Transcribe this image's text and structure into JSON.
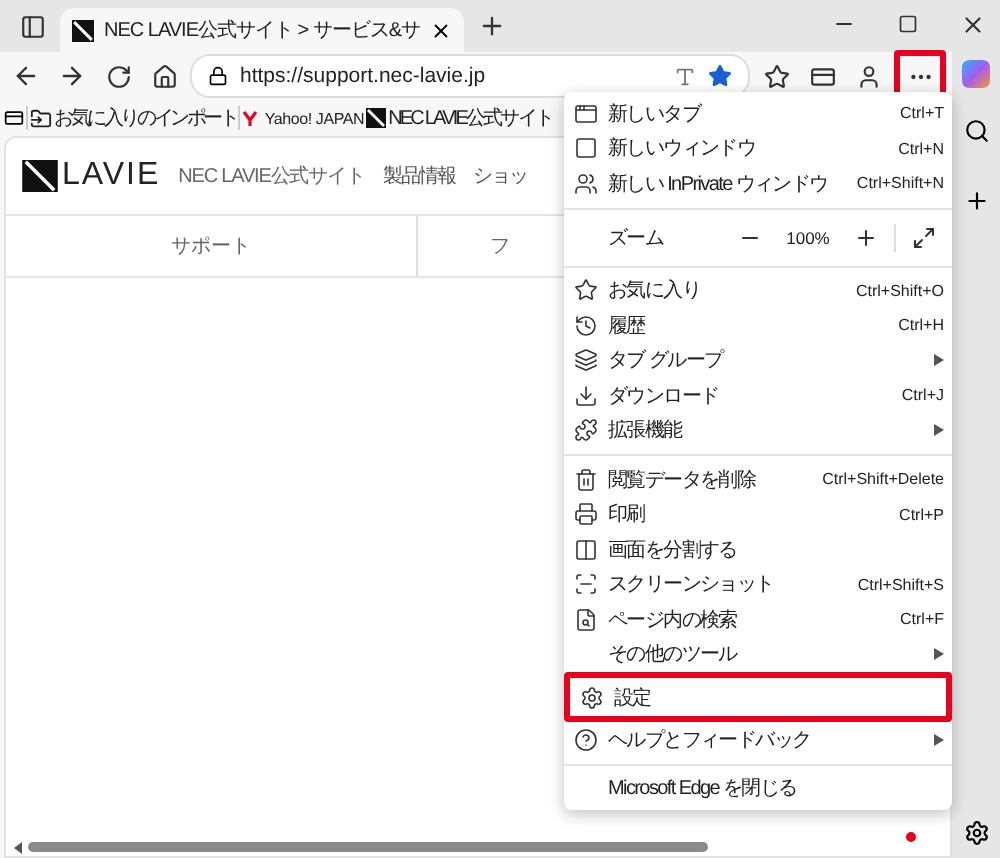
{
  "tab": {
    "title": "NEC LAVIE公式サイト > サービス&サ",
    "selected": true
  },
  "address_bar": {
    "url": "https://support.nec-lavie.jp",
    "favorited": true
  },
  "more_button": {
    "highlighted": true
  },
  "bookmarks": [
    {
      "label": "お気に入りのインポート"
    },
    {
      "label": "Yahoo! JAPAN"
    },
    {
      "label": "NEC LAVIE公式サイト"
    }
  ],
  "page": {
    "logo": "LAVIE",
    "site_name": "NEC LAVIE公式サイト",
    "nav": [
      "製品情報",
      "ショッ"
    ],
    "subnav": [
      "サポート",
      "フ"
    ]
  },
  "menu": {
    "items": [
      {
        "kind": "item",
        "label": "新しいタブ",
        "shortcut": "Ctrl+T",
        "submenu": false,
        "highlighted": false
      },
      {
        "kind": "item",
        "label": "新しいウィンドウ",
        "shortcut": "Ctrl+N",
        "submenu": false,
        "highlighted": false
      },
      {
        "kind": "item",
        "label": "新しい InPrivate ウィンドウ",
        "shortcut": "Ctrl+Shift+N",
        "submenu": false,
        "highlighted": false
      },
      {
        "kind": "separator"
      },
      {
        "kind": "zoom",
        "label": "ズーム",
        "value": "100%"
      },
      {
        "kind": "separator"
      },
      {
        "kind": "item",
        "label": "お気に入り",
        "shortcut": "Ctrl+Shift+O",
        "submenu": false,
        "highlighted": false
      },
      {
        "kind": "item",
        "label": "履歴",
        "shortcut": "Ctrl+H",
        "submenu": false,
        "highlighted": false
      },
      {
        "kind": "item",
        "label": "タブ グループ",
        "submenu": true,
        "highlighted": false
      },
      {
        "kind": "item",
        "label": "ダウンロード",
        "shortcut": "Ctrl+J",
        "submenu": false,
        "highlighted": false
      },
      {
        "kind": "item",
        "label": "拡張機能",
        "submenu": true,
        "highlighted": false
      },
      {
        "kind": "separator"
      },
      {
        "kind": "item",
        "label": "閲覧データを削除",
        "shortcut": "Ctrl+Shift+Delete",
        "submenu": false,
        "highlighted": false
      },
      {
        "kind": "item",
        "label": "印刷",
        "shortcut": "Ctrl+P",
        "submenu": false,
        "highlighted": false
      },
      {
        "kind": "item",
        "label": "画面を分割する",
        "submenu": false,
        "highlighted": false
      },
      {
        "kind": "item",
        "label": "スクリーンショット",
        "shortcut": "Ctrl+Shift+S",
        "submenu": false,
        "highlighted": false
      },
      {
        "kind": "item",
        "label": "ページ内の検索",
        "shortcut": "Ctrl+F",
        "submenu": false,
        "highlighted": false
      },
      {
        "kind": "item",
        "label": "その他のツール",
        "submenu": true,
        "highlighted": false
      },
      {
        "kind": "item",
        "label": "設定",
        "submenu": false,
        "highlighted": true
      },
      {
        "kind": "item",
        "label": "ヘルプとフィードバック",
        "submenu": true,
        "highlighted": false
      },
      {
        "kind": "separator"
      },
      {
        "kind": "item",
        "label": "Microsoft Edge を閉じる",
        "submenu": false,
        "highlighted": false
      }
    ]
  }
}
